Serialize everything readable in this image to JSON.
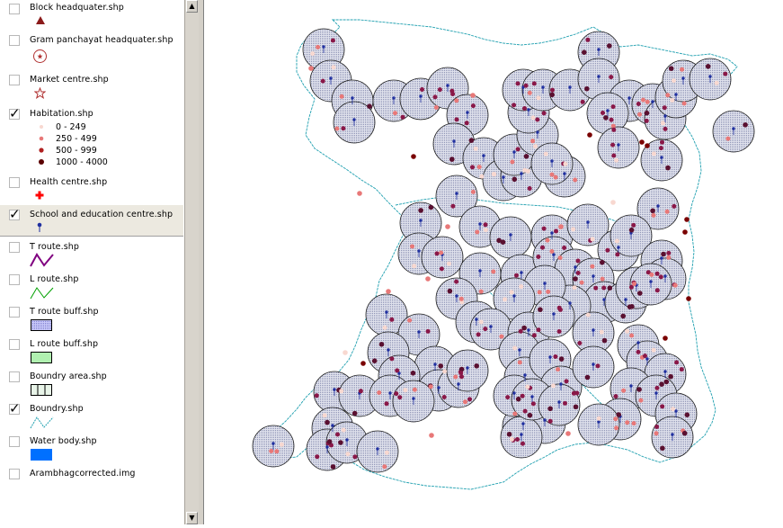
{
  "layers": [
    {
      "name": "Block headquater.shp",
      "checked": false,
      "symbol": "triangle-icon",
      "color": "#8b1a1a"
    },
    {
      "name": "Gram panchayat headquater.shp",
      "checked": false,
      "symbol": "circle-star-icon",
      "color": "#b03030"
    },
    {
      "name": "Market centre.shp",
      "checked": false,
      "symbol": "star-outline-icon",
      "color": "#b03030"
    },
    {
      "name": "Habitation.shp",
      "checked": true,
      "symbol": "graduated-dots",
      "classes": [
        {
          "label": "0 - 249",
          "color": "#f8d8d0"
        },
        {
          "label": "250 - 499",
          "color": "#e87878"
        },
        {
          "label": "500 - 999",
          "color": "#b02020"
        },
        {
          "label": "1000 - 4000",
          "color": "#5a0000"
        }
      ]
    },
    {
      "name": "Health centre.shp",
      "checked": false,
      "symbol": "cross-icon",
      "color": "#ff0000"
    },
    {
      "name": "School and education centre.shp",
      "checked": true,
      "symbol": "pin-icon",
      "color": "#2030a0"
    },
    {
      "name": "T route.shp",
      "checked": false,
      "symbol": "zigzag-line-icon",
      "color": "#800080"
    },
    {
      "name": "L route.shp",
      "checked": false,
      "symbol": "zigzag-line-icon",
      "color": "#00a000"
    },
    {
      "name": "T route buff.shp",
      "checked": false,
      "symbol": "hatched-fill-icon",
      "color": "#b8b8f0"
    },
    {
      "name": "L route buff.shp",
      "checked": false,
      "symbol": "fill-icon",
      "color": "#b0f0b0"
    },
    {
      "name": "Boundry area.shp",
      "checked": false,
      "symbol": "grid-fill-icon",
      "color": "#e0f0e0"
    },
    {
      "name": "Boundry.shp",
      "checked": true,
      "symbol": "dashed-line-icon",
      "color": "#20a0b0"
    },
    {
      "name": "Water body.shp",
      "checked": false,
      "symbol": "fill-icon",
      "color": "#0070ff"
    },
    {
      "name": "Arambhagcorrected.img",
      "checked": false,
      "symbol": "none"
    }
  ],
  "colors": {
    "buffer_fill": "#c8ccdc",
    "buffer_stroke": "#000000",
    "boundary": "#20a0b0",
    "school": "#2030a0"
  }
}
